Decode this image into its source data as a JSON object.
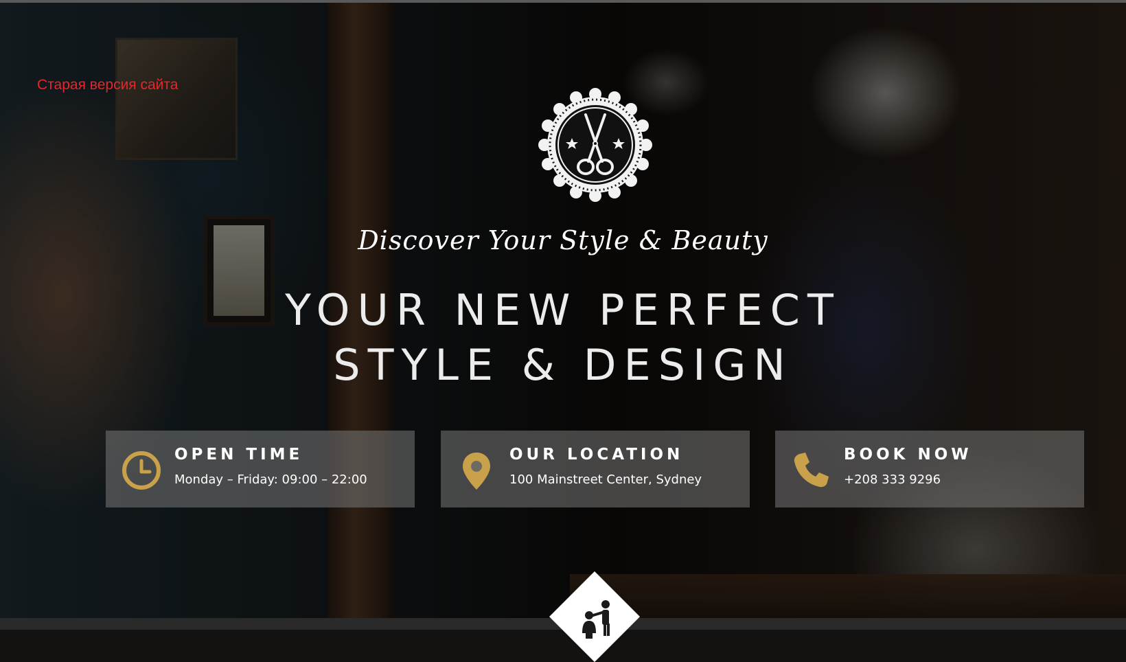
{
  "top_link": {
    "label": "Старая версия сайта"
  },
  "hero": {
    "logo_icon": "scissors-badge-icon",
    "tagline": "Discover Your Style & Beauty",
    "headline_line1": "YOUR NEW PERFECT",
    "headline_line2": "STYLE & DESIGN"
  },
  "info_cards": [
    {
      "icon": "clock-icon",
      "title": "OPEN TIME",
      "text": "Monday – Friday: 09:00 – 22:00"
    },
    {
      "icon": "map-pin-icon",
      "title": "OUR LOCATION",
      "text": "100 Mainstreet Center, Sydney"
    },
    {
      "icon": "phone-icon",
      "title": "BOOK NOW",
      "text": "+208 333 9296"
    }
  ],
  "scroll_badge": {
    "icon": "barber-icon"
  },
  "colors": {
    "accent_gold": "#c9a14a",
    "old_link_red": "#e8262a",
    "card_background": "rgba(120,120,120,0.55)",
    "text_white": "#ffffff"
  }
}
